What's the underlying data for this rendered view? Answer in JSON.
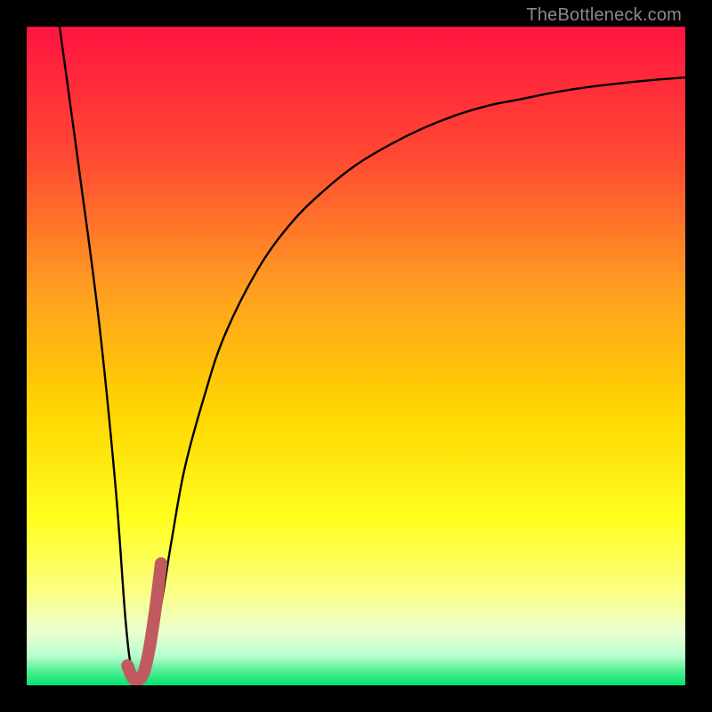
{
  "attribution": "TheBottleneck.com",
  "colors": {
    "frame": "#000000",
    "attribution_text": "#8a8a8a",
    "curve": "#000000",
    "highlight": "#c15a60",
    "gradient_top": "#ff1440",
    "gradient_mid1": "#ff802a",
    "gradient_mid2": "#ffd400",
    "gradient_mid3": "#ffff20",
    "gradient_mid4": "#f7ffb0",
    "gradient_bottom": "#00e46a"
  },
  "chart_data": {
    "type": "line",
    "title": "",
    "xlabel": "",
    "ylabel": "",
    "x_range": [
      0,
      100
    ],
    "y_range": [
      0,
      100
    ],
    "series": [
      {
        "name": "bottleneck-curve",
        "x": [
          5,
          8,
          11,
          13.5,
          15,
          16,
          17,
          18,
          20,
          22,
          24,
          27,
          30,
          35,
          40,
          45,
          50,
          55,
          60,
          65,
          70,
          75,
          80,
          85,
          90,
          95,
          100
        ],
        "y": [
          100,
          78,
          55,
          30,
          10,
          2,
          0.5,
          2,
          10,
          22,
          33,
          44,
          53,
          63,
          70,
          75,
          79,
          82,
          84.5,
          86.5,
          88,
          89,
          90,
          90.8,
          91.4,
          91.9,
          92.3
        ]
      }
    ],
    "highlight_segment": {
      "name": "highlight",
      "x": [
        15.3,
        16.0,
        16.8,
        17.8,
        18.7,
        19.6,
        20.4
      ],
      "y": [
        3.0,
        1.3,
        0.8,
        2.0,
        6.0,
        12.0,
        18.5
      ]
    },
    "gradient_stops": [
      {
        "offset": 0.0,
        "color": "#ff1440"
      },
      {
        "offset": 0.2,
        "color": "#ff4a33"
      },
      {
        "offset": 0.4,
        "color": "#ff9f20"
      },
      {
        "offset": 0.58,
        "color": "#ffd400"
      },
      {
        "offset": 0.75,
        "color": "#ffff20"
      },
      {
        "offset": 0.86,
        "color": "#fbff86"
      },
      {
        "offset": 0.92,
        "color": "#eaffd0"
      },
      {
        "offset": 0.955,
        "color": "#b8ffcf"
      },
      {
        "offset": 0.975,
        "color": "#60f09a"
      },
      {
        "offset": 1.0,
        "color": "#00e46a"
      }
    ]
  }
}
